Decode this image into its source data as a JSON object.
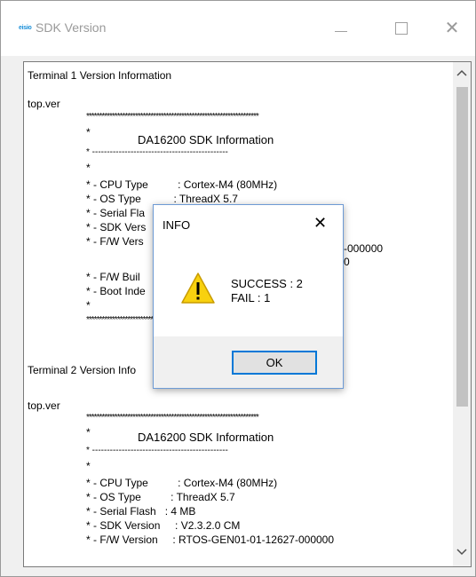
{
  "window": {
    "title": "SDK Version",
    "icon_text": "eisio",
    "minimize_icon": "minimize-icon",
    "maximize_icon": "maximize-icon",
    "close_glyph": "✕"
  },
  "terminal1": {
    "header": "Terminal 1 Version Information",
    "file": "top.ver",
    "stars": "*******************************************************************",
    "star": "*",
    "title": "DA16200 SDK Information",
    "dashes": "* ----------------------------------------------",
    "cpu": "* - CPU Type          : Cortex-M4 (80MHz)",
    "os": "* - OS Type           : ThreadX 5.7",
    "flash": "* - Serial Fla",
    "sdk": "* - SDK Vers",
    "fw": "* - F/W Vers",
    "fw_tail": "-000000",
    "extra_tail": "0",
    "build": "* - F/W Buil",
    "boot": "* - Boot Inde"
  },
  "terminal2": {
    "header": "Terminal 2 Version Info",
    "file": "top.ver",
    "stars": "*******************************************************************",
    "star": "*",
    "title": "DA16200 SDK Information",
    "dashes": "* ----------------------------------------------",
    "cpu": "* - CPU Type          : Cortex-M4 (80MHz)",
    "os": "* - OS Type          : ThreadX 5.7",
    "flash": "* - Serial Flash   : 4 MB",
    "sdk": "* - SDK Version     : V2.3.2.0 CM",
    "fw": "* - F/W Version     : RTOS-GEN01-01-12627-000000"
  },
  "scrollbar": {
    "up": "^",
    "down": "v"
  },
  "dialog": {
    "title": "INFO",
    "close_glyph": "✕",
    "success": "SUCCESS : 2",
    "fail": "FAIL : 1",
    "ok_label": "OK",
    "icon": "warning-icon",
    "icon_colors": {
      "fill": "#f8d10f",
      "stroke": "#c89b00",
      "mark": "#000000"
    }
  }
}
